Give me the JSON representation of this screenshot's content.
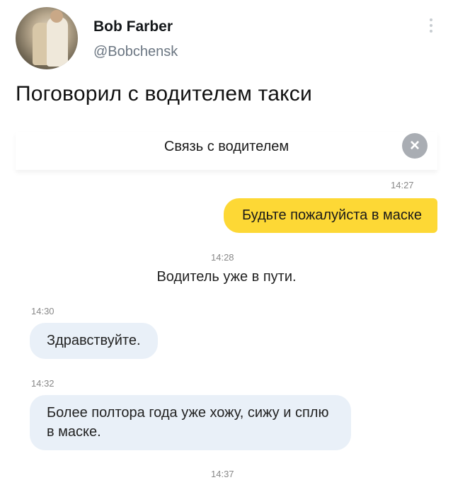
{
  "tweet": {
    "user_name": "Bob Farber",
    "user_handle": "@Bobchensk",
    "text": "Поговорил с водителем такси"
  },
  "chat": {
    "title": "Связь с водителем",
    "close_icon": "×",
    "messages": [
      {
        "time": "14:27",
        "text": "Будьте пожалуйста в маске",
        "from": "user"
      },
      {
        "time": "14:28",
        "text": "Водитель уже в пути.",
        "from": "system"
      },
      {
        "time": "14:30",
        "text": "Здравствуйте.",
        "from": "driver"
      },
      {
        "time": "14:32",
        "text": "Более полтора года уже хожу, сижу и сплю в маске.",
        "from": "driver"
      },
      {
        "time": "14:37",
        "text": "",
        "from": "user"
      }
    ]
  },
  "icons": {
    "more": "more-vertical-icon",
    "close": "close-icon",
    "avatar": "avatar-photo"
  },
  "colors": {
    "user_bubble": "#fdd835",
    "driver_bubble": "#e9f0f8",
    "handle": "#6b7682",
    "close_bg": "#a9adb3"
  }
}
